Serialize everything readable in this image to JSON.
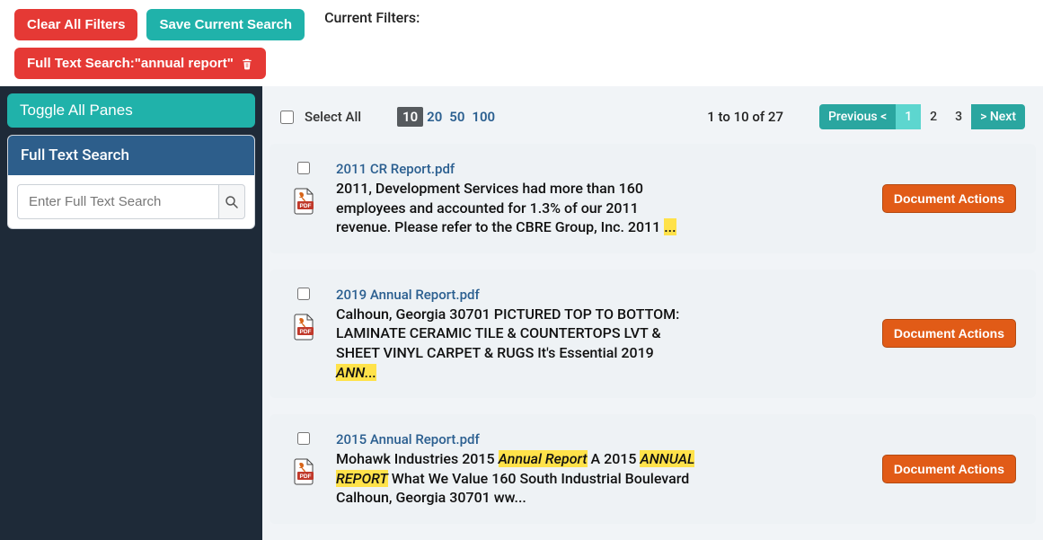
{
  "top": {
    "clear_filters": "Clear All Filters",
    "save_search": "Save Current Search",
    "filter_chip": "Full Text Search:\"annual report\"",
    "current_filters_label": "Current Filters:"
  },
  "sidebar": {
    "toggle_panes": "Toggle All Panes",
    "search_header": "Full Text Search",
    "search_placeholder": "Enter Full Text Search"
  },
  "results_bar": {
    "select_all": "Select All",
    "page_sizes": [
      "10",
      "20",
      "50",
      "100"
    ],
    "active_page_size_index": 0,
    "count_text": "1 to 10 of 27",
    "prev_label": "Previous <",
    "next_label": "> Next",
    "pages": [
      "1",
      "2",
      "3"
    ],
    "active_page_index": 0
  },
  "actions": {
    "doc_actions": "Document Actions"
  },
  "results": [
    {
      "title": "2011 CR Report.pdf",
      "snippet_parts": [
        {
          "t": "2011, Development Services had more than 160 employees and accounted for 1.3% of our 2011 revenue. Please refer to the CBRE Group, Inc. 2011 "
        },
        {
          "t": "...",
          "hl": true
        }
      ]
    },
    {
      "title": "2019 Annual Report.pdf",
      "snippet_parts": [
        {
          "t": "Calhoun, Georgia 30701 PICTURED TOP TO BOTTOM: LAMINATE CERAMIC TILE & COUNTERTOPS LVT & SHEET VINYL CARPET & RUGS It's Essential 2019 "
        },
        {
          "t": "ANN...",
          "hl": true,
          "italic": true
        }
      ]
    },
    {
      "title": "2015 Annual Report.pdf",
      "snippet_parts": [
        {
          "t": "Mohawk Industries 2015 "
        },
        {
          "t": "Annual Report",
          "hl": true,
          "italic": true
        },
        {
          "t": " A 2015 "
        },
        {
          "t": "ANNUAL REPORT",
          "hl": true,
          "italic": true
        },
        {
          "t": " What We Value 160 South Industrial Boulevard Calhoun, Georgia 30701 ww..."
        }
      ]
    }
  ]
}
